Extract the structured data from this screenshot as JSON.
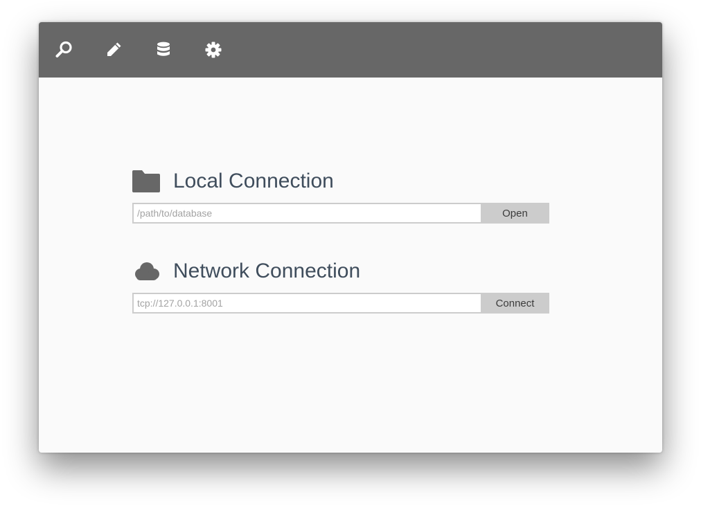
{
  "toolbar": {
    "icons": [
      "search-icon",
      "pencil-icon",
      "database-icon",
      "gear-icon"
    ]
  },
  "local": {
    "icon": "folder-icon",
    "title": "Local Connection",
    "placeholder": "/path/to/database",
    "value": "",
    "button_label": "Open"
  },
  "network": {
    "icon": "cloud-icon",
    "title": "Network Connection",
    "placeholder": "tcp://127.0.0.1:8001",
    "value": "",
    "button_label": "Connect"
  },
  "colors": {
    "toolbar_bg": "#676767",
    "content_bg": "#fafafa",
    "title_text": "#3f4d5c",
    "icon_gray": "#676767",
    "button_bg": "#cccccc"
  }
}
